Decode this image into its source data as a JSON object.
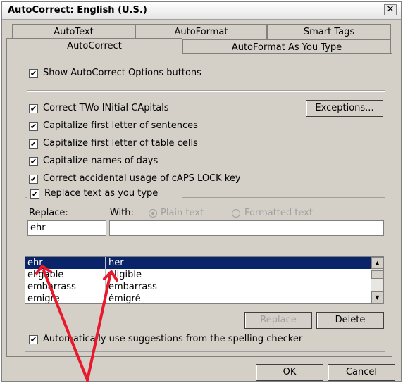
{
  "window": {
    "title": "AutoCorrect: English (U.S.)",
    "close": "✕"
  },
  "tabs": {
    "row1": [
      "AutoText",
      "AutoFormat",
      "Smart Tags"
    ],
    "row2": [
      "AutoCorrect",
      "AutoFormat As You Type"
    ],
    "active": "AutoCorrect"
  },
  "options": {
    "show_buttons": "Show AutoCorrect Options buttons",
    "two_initials": "Correct TWo INitial CApitals",
    "first_sentence": "Capitalize first letter of sentences",
    "first_table": "Capitalize first letter of table cells",
    "names_days": "Capitalize names of days",
    "caps_lock": "Correct accidental usage of cAPS LOCK key",
    "replace_text": "Replace text as you type",
    "spelling": "Automatically use suggestions from the spelling checker",
    "check": "✔"
  },
  "exceptions_button": "Exceptions...",
  "replace": {
    "replace_label": "Replace:",
    "with_label": "With:",
    "plain_text": "Plain text",
    "formatted_text": "Formatted text",
    "replace_value": "ehr",
    "with_value": ""
  },
  "entries": [
    {
      "from": "ehr",
      "to": "her"
    },
    {
      "from": "eligable",
      "to": "eligible"
    },
    {
      "from": "embarrass",
      "to": "embarrass"
    },
    {
      "from": "emigre",
      "to": "émigré"
    }
  ],
  "buttons": {
    "replace": "Replace",
    "delete": "Delete",
    "ok": "OK",
    "cancel": "Cancel"
  },
  "scroll": {
    "up": "▲",
    "down": "▼"
  },
  "colors": {
    "selection": "#0a246a",
    "arrow": "#e8192c"
  }
}
